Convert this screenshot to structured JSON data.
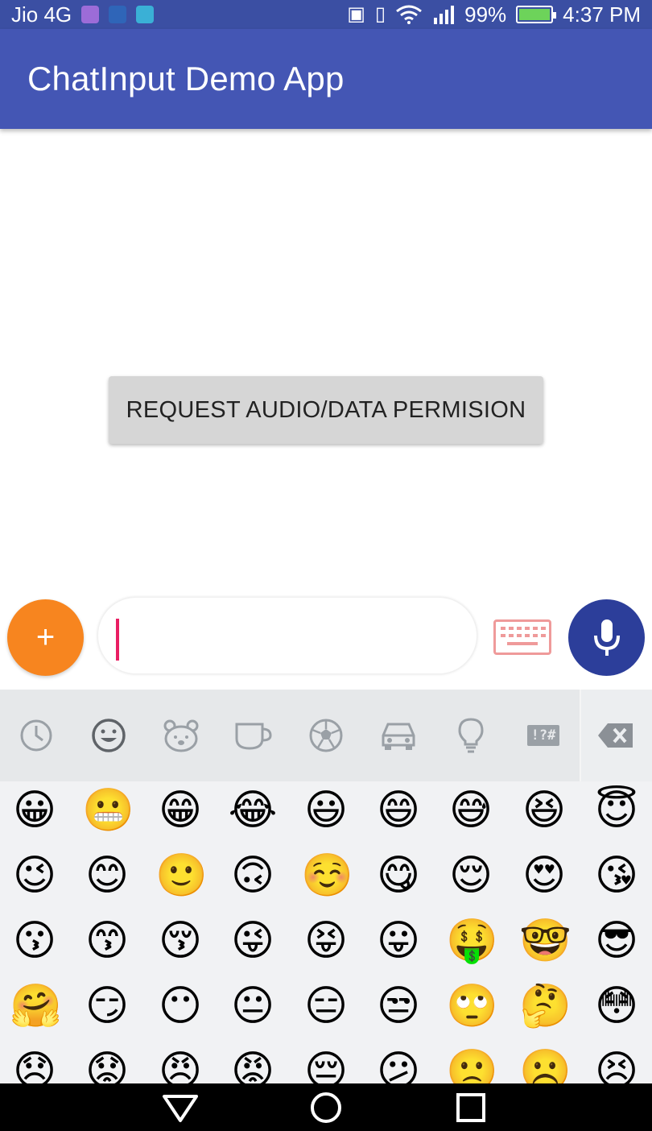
{
  "status_bar": {
    "carrier": "Jio 4G",
    "battery": "99%",
    "time": "4:37 PM",
    "battery_level": 0.99,
    "icons": [
      "notification-app-icon",
      "notification-app-icon",
      "notification-app-icon",
      "nfc-icon",
      "vibrate-icon",
      "wifi-icon",
      "signal-icon",
      "battery-charging-icon"
    ]
  },
  "app_bar": {
    "title": "ChatInput Demo App"
  },
  "content": {
    "permission_button": "REQUEST AUDIO/DATA PERMISION"
  },
  "chat_input": {
    "attach_label": "+",
    "text_value": "",
    "icons": [
      "add-icon",
      "keyboard-icon",
      "microphone-icon"
    ]
  },
  "emoji_tabs": {
    "icons": [
      "recent-clock-icon",
      "smiley-face-icon",
      "animal-bear-icon",
      "food-cup-icon",
      "sports-ball-icon",
      "travel-car-icon",
      "objects-lightbulb-icon",
      "symbols-icon",
      "backspace-icon"
    ],
    "symbols_label": "!?#",
    "selected": 1
  },
  "emoji_grid": {
    "rows": [
      [
        "😀",
        "😬",
        "😁",
        "😂",
        "😃",
        "😄",
        "😅",
        "😆",
        "😇"
      ],
      [
        "😉",
        "😊",
        "🙂",
        "🙃",
        "☺️",
        "😋",
        "😌",
        "😍",
        "😘"
      ],
      [
        "😗",
        "😙",
        "😚",
        "😜",
        "😝",
        "😛",
        "🤑",
        "🤓",
        "😎"
      ],
      [
        "🤗",
        "😏",
        "😶",
        "😐",
        "😑",
        "😒",
        "🙄",
        "🤔",
        "😳"
      ],
      [
        "😞",
        "😟",
        "😠",
        "😡",
        "😔",
        "😕",
        "🙁",
        "☹️",
        "😣"
      ]
    ]
  },
  "colors": {
    "status_bar": "#3b4fa3",
    "app_bar": "#4456b4",
    "fab_add": "#f7851f",
    "fab_mic": "#2c3e9a",
    "caret": "#e91e63",
    "keyboard_icon": "#ef9a9a"
  }
}
